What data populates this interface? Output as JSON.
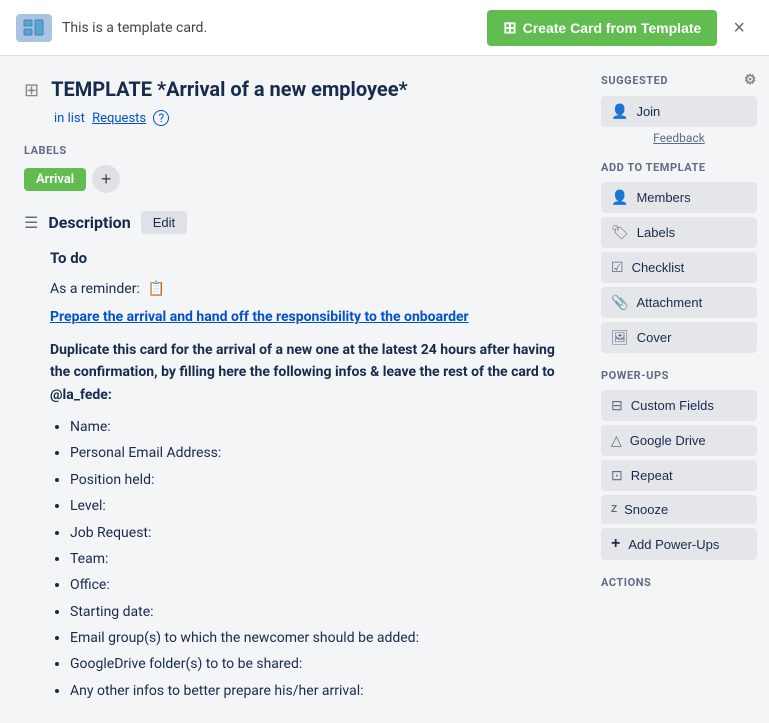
{
  "banner": {
    "text": "This is a template card.",
    "create_btn": "Create Card from Template",
    "close_label": "×"
  },
  "card": {
    "title": "TEMPLATE *Arrival of a new employee*",
    "in_list_prefix": "in list",
    "list_name": "Requests",
    "help_icon": "?"
  },
  "labels_section": {
    "heading": "LABELS",
    "label": "Arrival",
    "add_icon": "+"
  },
  "description": {
    "heading": "Description",
    "edit_btn": "Edit",
    "todo_heading": "To do",
    "reminder_prefix": "As a reminder:",
    "reminder_link": "Prepare the arrival and hand off the responsibility to the onboarder",
    "bold_text": "Duplicate this card for the arrival of a new one at the latest 24 hours after having the confirmation, by filling here the following infos & leave the rest of the card to @la_fede:",
    "list_items": [
      "Name:",
      "Personal Email Address:",
      "Position held:",
      "Level:",
      "Job Request:",
      "Team:",
      "Office:",
      "Starting date:",
      "Email group(s) to which the newcomer should be added:",
      "GoogleDrive folder(s) to to be shared:",
      "Any other infos to better prepare his/her arrival:"
    ]
  },
  "sidebar": {
    "suggested": {
      "heading": "SUGGESTED",
      "gear_icon": "⚙",
      "join_btn": "Join",
      "join_icon": "👤",
      "feedback_link": "Feedback"
    },
    "add_to_template": {
      "heading": "ADD TO TEMPLATE",
      "buttons": [
        {
          "label": "Members",
          "icon": "👤"
        },
        {
          "label": "Labels",
          "icon": "🏷"
        },
        {
          "label": "Checklist",
          "icon": "✅"
        },
        {
          "label": "Attachment",
          "icon": "📎"
        },
        {
          "label": "Cover",
          "icon": "🖼"
        }
      ]
    },
    "power_ups": {
      "heading": "POWER-UPS",
      "buttons": [
        {
          "label": "Custom Fields",
          "icon": "⊟"
        },
        {
          "label": "Google Drive",
          "icon": "△"
        },
        {
          "label": "Repeat",
          "icon": "⊡"
        },
        {
          "label": "Snooze",
          "icon": "Z"
        }
      ],
      "add_btn": "Add Power-Ups",
      "add_icon": "+"
    },
    "actions": {
      "heading": "ACTIONS"
    }
  }
}
